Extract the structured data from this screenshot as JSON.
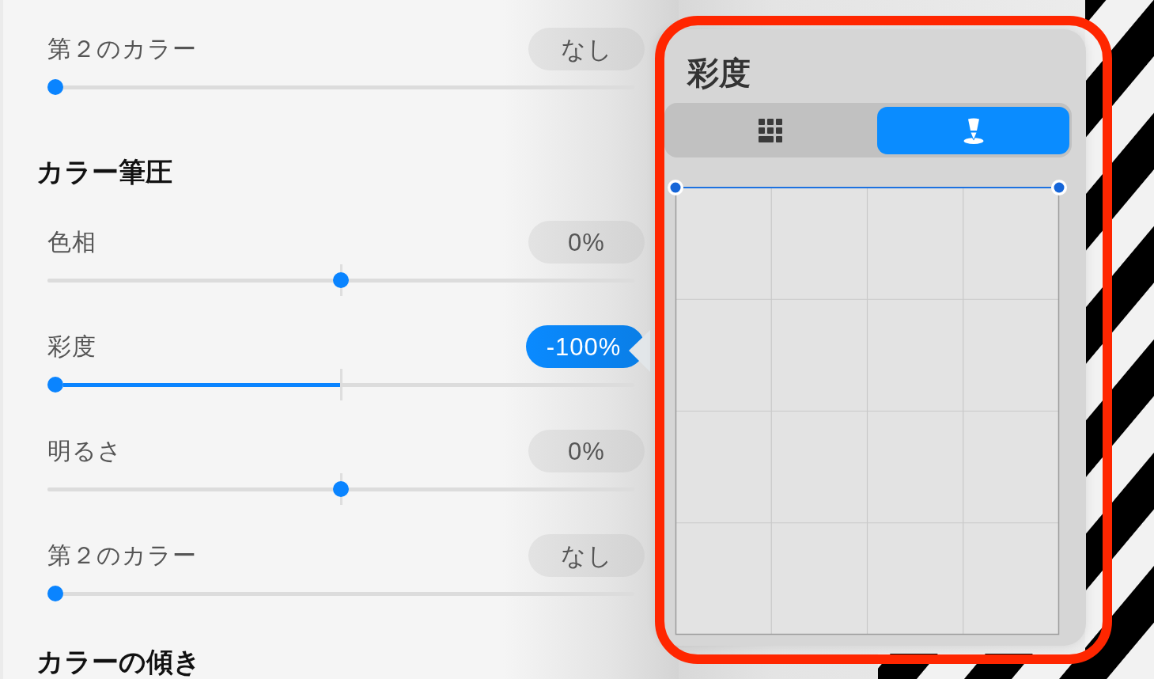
{
  "settings": [
    {
      "kind": "slider",
      "label": "第２のカラー",
      "value": "なし",
      "selected": false,
      "level": 0
    },
    {
      "kind": "heading",
      "label": "カラー筆圧"
    },
    {
      "kind": "bipolar",
      "label": "色相",
      "value": "0%",
      "selected": false,
      "level": 0.5
    },
    {
      "kind": "bipolar",
      "label": "彩度",
      "value": "-100%",
      "selected": true,
      "level": 0
    },
    {
      "kind": "bipolar",
      "label": "明るさ",
      "value": "0%",
      "selected": false,
      "level": 0.5
    },
    {
      "kind": "slider",
      "label": "第２のカラー",
      "value": "なし",
      "selected": false,
      "level": 0
    },
    {
      "kind": "heading",
      "label": "カラーの傾き"
    }
  ],
  "popover": {
    "title": "彩度",
    "modes": [
      {
        "kind": "grid",
        "selected": false
      },
      {
        "kind": "stylus",
        "selected": true
      }
    ]
  }
}
